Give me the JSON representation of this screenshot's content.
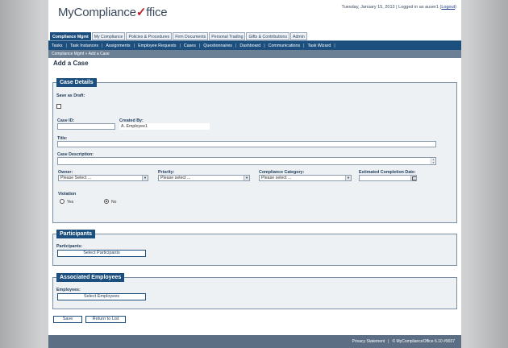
{
  "header": {
    "logo_text_a": "MyCompliance",
    "logo_check": "✓",
    "logo_text_b": "ffice",
    "date": "Tuesday, January 15, 2013",
    "logged_in_as": "| Logged in as",
    "username": "auser1",
    "logout_label": "Logout"
  },
  "tabs": [
    "Compliance Mgmt",
    "My Compliance",
    "Policies & Procedures",
    "Firm Documents",
    "Personal Trading",
    "Gifts & Contributions",
    "Admin"
  ],
  "subnav": [
    "Tasks",
    "Task Instances",
    "Assignments",
    "Employee Requests",
    "Cases",
    "Questionnaires",
    "Dashboard",
    "Communications",
    "Task Wizard"
  ],
  "breadcrumb": "Compliance Mgmt »  Add a Case",
  "page_title": "Add a Case",
  "case_details": {
    "title": "Case Details",
    "save_as_draft_label": "Save as Draft:",
    "case_id_label": "Case ID:",
    "case_id_value": "",
    "created_by_label": "Created By:",
    "created_by_value": "A. Employee1",
    "title_label": "Title:",
    "title_value": "",
    "description_label": "Case Description:",
    "owner_label": "Owner:",
    "owner_value": "Please Select ...",
    "priority_label": "Priority:",
    "priority_value": "Please select ...",
    "category_label": "Compliance Category:",
    "category_value": "Please select ...",
    "completion_date_label": "Estimated Completion Date:",
    "violation_label": "Violation",
    "yes_label": "Yes",
    "no_label": "No",
    "violation_selected": "No"
  },
  "participants": {
    "title": "Participants",
    "label": "Participants:",
    "button": "Select Participants"
  },
  "associated_employees": {
    "title": "Associated Employees",
    "label": "Employees:",
    "button": "Select Employees"
  },
  "actions": {
    "save": "Save",
    "return": "Return to List"
  },
  "footer": {
    "privacy": "Privacy Statement",
    "copyright": "© MyComplianceOffice 6.10 #9037"
  }
}
